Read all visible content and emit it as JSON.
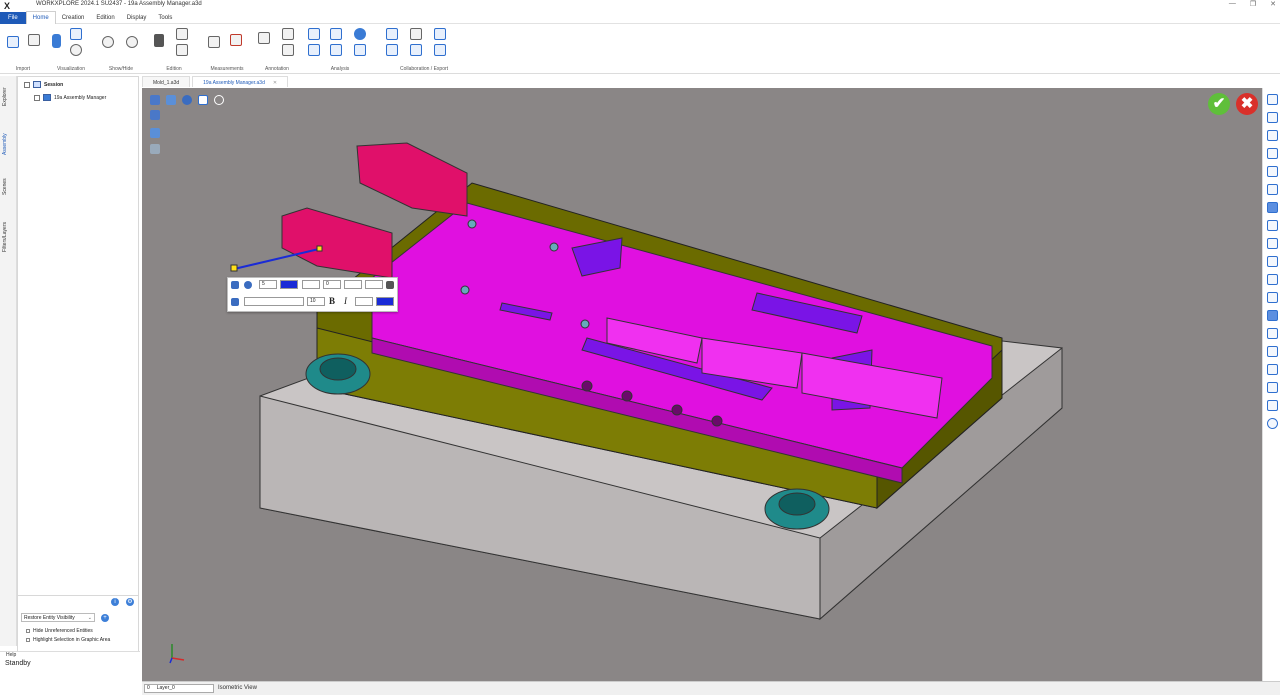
{
  "window": {
    "title": "WORKXPLORE 2024.1 SU2437 - 19a Assembly Manager.a3d",
    "logo": "X",
    "minimize": "—",
    "maximize": "❐",
    "close": "✕"
  },
  "menu": [
    "File",
    "Home",
    "Creation",
    "Edition",
    "Display",
    "Tools"
  ],
  "ribbon_groups": [
    "Import",
    "Visualization",
    "Show/Hide",
    "Edition",
    "Measurements",
    "Annotation",
    "Analysis",
    "Collaboration / Export"
  ],
  "doc_tabs": [
    {
      "label": "Mold_1.a3d",
      "active": false
    },
    {
      "label": "19a Assembly Manager.a3d",
      "active": true
    }
  ],
  "left_tabs": [
    "Explorer",
    "Assembly",
    "Scenes",
    "Filters/Layers"
  ],
  "tree": {
    "root": "Session",
    "child": "19a Assembly Manager"
  },
  "panel": {
    "dropdown": "Restore Entity Visibility",
    "check1": "Hide Unreferenced Entities",
    "check2": "Highlight Selection in Graphic Area"
  },
  "help": {
    "label": "Help",
    "status": "Standby"
  },
  "annotation_toolbar": {
    "size1": "5",
    "size2": "0",
    "font_size": "10",
    "bold": "B",
    "italic": "I"
  },
  "viewport": {
    "ok": "✔",
    "cancel": "✖"
  },
  "statusbar": {
    "layer": "Layer_0",
    "layer_prefix": "0",
    "view": "Isometric View"
  },
  "colors": {
    "accent": "#1e5ab8",
    "viewport_bg": "#8a8686",
    "cavity": "#e010e0",
    "frame": "#6b6b00",
    "base": "#c9c5c5",
    "parts": "#e0106a",
    "inserts": "#7a14e6",
    "clamps": "#1f8a8a"
  }
}
